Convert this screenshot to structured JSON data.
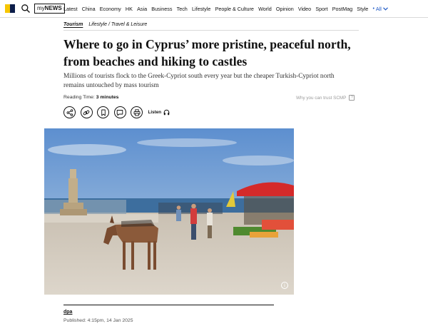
{
  "nav": {
    "search_icon": "search-icon",
    "mynews_prefix": "my",
    "mynews_suffix": "NEWS",
    "links": [
      "Latest",
      "China",
      "Economy",
      "HK",
      "Asia",
      "Business",
      "Tech",
      "Lifestyle",
      "People & Culture",
      "World",
      "Opinion",
      "Video",
      "Sport",
      "PostMag",
      "Style"
    ],
    "all_label": "All",
    "dot": "•"
  },
  "article": {
    "section": "Tourism",
    "breadcrumb": "Lifestyle / Travel & Leisure",
    "title": "Where to go in Cyprus’ more pristine, peaceful north, from beaches and hiking to castles",
    "subtitle": "Millions of tourists flock to the Greek-Cypriot south every year but the cheaper Turkish-Cypriot north remains untouched by mass tourism",
    "reading_label": "Reading Time:",
    "reading_value": "3 minutes",
    "trust_label": "Why you can trust SCMP",
    "listen_label": "Listen",
    "author": "dpa",
    "published": "Published: 4:15pm, 14 Jan 2025"
  },
  "colors": {
    "brand_yellow": "#f7c600",
    "brand_navy": "#0c1d4a",
    "link_blue": "#1a55c4"
  }
}
